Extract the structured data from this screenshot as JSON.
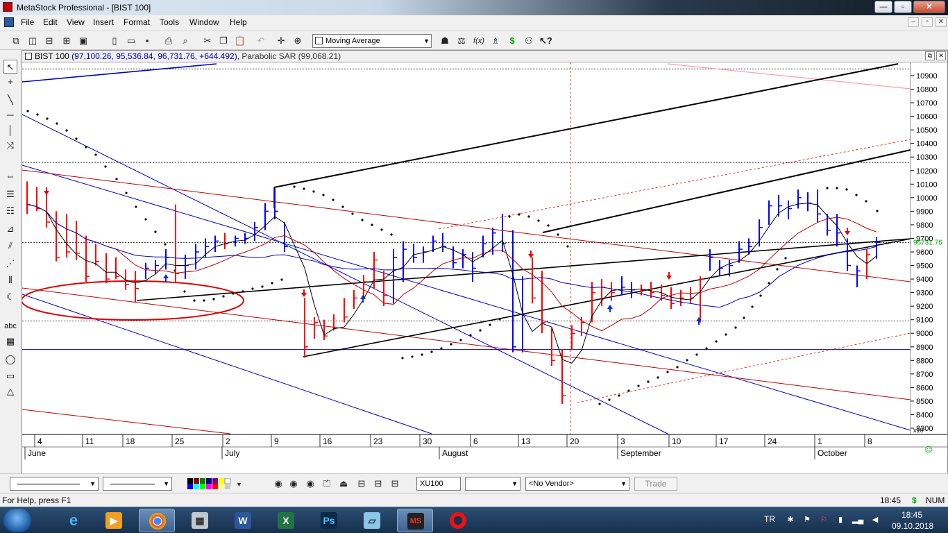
{
  "window": {
    "title": "MetaStock Professional - [BIST 100]",
    "controls": {
      "minimize": "—",
      "restore": "▫",
      "close": "✕"
    }
  },
  "menu": {
    "items": [
      "File",
      "Edit",
      "View",
      "Insert",
      "Format",
      "Tools",
      "Window",
      "Help"
    ],
    "mdi": {
      "minimize": "–",
      "restore": "▫",
      "close": "✕"
    }
  },
  "toolbar": {
    "indicator_selected": "Moving Average"
  },
  "chart": {
    "header_symbol": "BIST 100",
    "header_ohlc": "(97,100.26, 95,536.84, 96,731.76, +644.492),",
    "header_indicator": "Parabolic SAR (99,068.21)",
    "price_label": "96731.76",
    "scale_multiplier": "x10",
    "y_ticks": [
      "10900",
      "10800",
      "10700",
      "10600",
      "10500",
      "10400",
      "10300",
      "10200",
      "10100",
      "10000",
      "9900",
      "9800",
      "9700",
      "9600",
      "9500",
      "9400",
      "9300",
      "9200",
      "9100",
      "9000",
      "8900",
      "8800",
      "8700",
      "8600",
      "8500",
      "8400",
      "8300"
    ],
    "day_ticks": [
      "4",
      "11",
      "18",
      "25",
      "2",
      "9",
      "16",
      "23",
      "30",
      "6",
      "13",
      "20",
      "3",
      "10",
      "17",
      "24",
      "1",
      "8"
    ],
    "month_labels": [
      "June",
      "July",
      "August",
      "September",
      "October"
    ],
    "bar_colors": {
      "up": "#0000ff",
      "down": "#ff0000",
      "line": "#000000"
    }
  },
  "chart_data": {
    "type": "ohlc",
    "title": "BIST 100",
    "y_unit_multiplier": 10,
    "ylim": [
      8300,
      10950
    ],
    "bars": [
      {
        "x": 38,
        "h": 10120,
        "l": 9880,
        "c": 9950,
        "d": "down"
      },
      {
        "x": 52,
        "h": 10080,
        "l": 9900,
        "c": 9920,
        "d": "down"
      },
      {
        "x": 66,
        "h": 10050,
        "l": 9780,
        "c": 9820,
        "d": "down"
      },
      {
        "x": 80,
        "h": 9900,
        "l": 9530,
        "c": 9560,
        "d": "down"
      },
      {
        "x": 95,
        "h": 9880,
        "l": 9560,
        "c": 9600,
        "d": "down"
      },
      {
        "x": 109,
        "h": 9830,
        "l": 9540,
        "c": 9590,
        "d": "down"
      },
      {
        "x": 123,
        "h": 9720,
        "l": 9380,
        "c": 9420,
        "d": "down"
      },
      {
        "x": 137,
        "h": 9660,
        "l": 9500,
        "c": 9530,
        "d": "down"
      },
      {
        "x": 152,
        "h": 9590,
        "l": 9370,
        "c": 9400,
        "d": "down"
      },
      {
        "x": 166,
        "h": 9560,
        "l": 9400,
        "c": 9420,
        "d": "down"
      },
      {
        "x": 180,
        "h": 9470,
        "l": 9320,
        "c": 9360,
        "d": "down"
      },
      {
        "x": 194,
        "h": 9460,
        "l": 9230,
        "c": 9330,
        "d": "down"
      },
      {
        "x": 209,
        "h": 9520,
        "l": 9400,
        "c": 9480,
        "d": "up"
      },
      {
        "x": 223,
        "h": 9540,
        "l": 9440,
        "c": 9500,
        "d": "up"
      },
      {
        "x": 238,
        "h": 9620,
        "l": 9470,
        "c": 9560,
        "d": "up"
      },
      {
        "x": 252,
        "h": 9950,
        "l": 9380,
        "c": 9440,
        "d": "down"
      },
      {
        "x": 266,
        "h": 9580,
        "l": 9400,
        "c": 9500,
        "d": "up"
      },
      {
        "x": 281,
        "h": 9660,
        "l": 9470,
        "c": 9600,
        "d": "up"
      },
      {
        "x": 295,
        "h": 9700,
        "l": 9560,
        "c": 9640,
        "d": "up"
      },
      {
        "x": 309,
        "h": 9720,
        "l": 9600,
        "c": 9680,
        "d": "up"
      },
      {
        "x": 323,
        "h": 9740,
        "l": 9620,
        "c": 9660,
        "d": "down"
      },
      {
        "x": 338,
        "h": 9720,
        "l": 9640,
        "c": 9700,
        "d": "up"
      },
      {
        "x": 352,
        "h": 9740,
        "l": 9660,
        "c": 9700,
        "d": "up"
      },
      {
        "x": 366,
        "h": 9820,
        "l": 9680,
        "c": 9780,
        "d": "up"
      },
      {
        "x": 381,
        "h": 9960,
        "l": 9760,
        "c": 9900,
        "d": "up"
      },
      {
        "x": 395,
        "h": 10070,
        "l": 9840,
        "c": 9900,
        "d": "up"
      },
      {
        "x": 409,
        "h": 9820,
        "l": 9600,
        "c": 9640,
        "d": "up"
      },
      {
        "x": 438,
        "h": 9260,
        "l": 8820,
        "c": 8900,
        "d": "down"
      },
      {
        "x": 452,
        "h": 9120,
        "l": 8960,
        "c": 9080,
        "d": "down"
      },
      {
        "x": 466,
        "h": 9100,
        "l": 8950,
        "c": 8980,
        "d": "down"
      },
      {
        "x": 480,
        "h": 9140,
        "l": 9020,
        "c": 9040,
        "d": "down"
      },
      {
        "x": 495,
        "h": 9260,
        "l": 9080,
        "c": 9120,
        "d": "down"
      },
      {
        "x": 509,
        "h": 9320,
        "l": 9180,
        "c": 9260,
        "d": "down"
      },
      {
        "x": 523,
        "h": 9430,
        "l": 9260,
        "c": 9380,
        "d": "down"
      },
      {
        "x": 538,
        "h": 9600,
        "l": 9330,
        "c": 9540,
        "d": "down"
      },
      {
        "x": 552,
        "h": 9460,
        "l": 9200,
        "c": 9280,
        "d": "down"
      },
      {
        "x": 566,
        "h": 9620,
        "l": 9220,
        "c": 9560,
        "d": "up"
      },
      {
        "x": 580,
        "h": 9680,
        "l": 9380,
        "c": 9620,
        "d": "up"
      },
      {
        "x": 595,
        "h": 9660,
        "l": 9520,
        "c": 9560,
        "d": "up"
      },
      {
        "x": 609,
        "h": 9640,
        "l": 9520,
        "c": 9600,
        "d": "up"
      },
      {
        "x": 623,
        "h": 9720,
        "l": 9600,
        "c": 9680,
        "d": "up"
      },
      {
        "x": 637,
        "h": 9740,
        "l": 9600,
        "c": 9640,
        "d": "up"
      },
      {
        "x": 652,
        "h": 9640,
        "l": 9480,
        "c": 9520,
        "d": "up"
      },
      {
        "x": 666,
        "h": 9620,
        "l": 9480,
        "c": 9580,
        "d": "up"
      },
      {
        "x": 680,
        "h": 9600,
        "l": 9380,
        "c": 9480,
        "d": "up"
      },
      {
        "x": 695,
        "h": 9720,
        "l": 9560,
        "c": 9660,
        "d": "up"
      },
      {
        "x": 709,
        "h": 9780,
        "l": 9580,
        "c": 9740,
        "d": "up"
      },
      {
        "x": 723,
        "h": 9880,
        "l": 9600,
        "c": 9660,
        "d": "up"
      },
      {
        "x": 738,
        "h": 9760,
        "l": 8860,
        "c": 8900,
        "d": "up"
      },
      {
        "x": 752,
        "h": 9420,
        "l": 8860,
        "c": 8880,
        "d": "up"
      },
      {
        "x": 766,
        "h": 9560,
        "l": 9220,
        "c": 9260,
        "d": "down"
      },
      {
        "x": 780,
        "h": 9460,
        "l": 9000,
        "c": 9080,
        "d": "down"
      },
      {
        "x": 794,
        "h": 9040,
        "l": 8760,
        "c": 8800,
        "d": "down"
      },
      {
        "x": 809,
        "h": 8880,
        "l": 8480,
        "c": 8540,
        "d": "down"
      },
      {
        "x": 823,
        "h": 9060,
        "l": 8880,
        "c": 9000,
        "d": "down"
      },
      {
        "x": 837,
        "h": 9120,
        "l": 8980,
        "c": 9080,
        "d": "down"
      },
      {
        "x": 852,
        "h": 9380,
        "l": 9080,
        "c": 9300,
        "d": "down"
      },
      {
        "x": 866,
        "h": 9400,
        "l": 9200,
        "c": 9340,
        "d": "down"
      },
      {
        "x": 880,
        "h": 9380,
        "l": 9240,
        "c": 9300,
        "d": "down"
      },
      {
        "x": 895,
        "h": 9420,
        "l": 9280,
        "c": 9340,
        "d": "up"
      },
      {
        "x": 909,
        "h": 9380,
        "l": 9260,
        "c": 9320,
        "d": "up"
      },
      {
        "x": 923,
        "h": 9360,
        "l": 9280,
        "c": 9320,
        "d": "down"
      },
      {
        "x": 937,
        "h": 9380,
        "l": 9260,
        "c": 9300,
        "d": "down"
      },
      {
        "x": 952,
        "h": 9360,
        "l": 9240,
        "c": 9280,
        "d": "down"
      },
      {
        "x": 966,
        "h": 9340,
        "l": 9180,
        "c": 9220,
        "d": "down"
      },
      {
        "x": 980,
        "h": 9320,
        "l": 9200,
        "c": 9260,
        "d": "down"
      },
      {
        "x": 994,
        "h": 9340,
        "l": 9220,
        "c": 9260,
        "d": "down"
      },
      {
        "x": 1008,
        "h": 9420,
        "l": 9080,
        "c": 9400,
        "d": "down"
      },
      {
        "x": 1022,
        "h": 9620,
        "l": 9460,
        "c": 9560,
        "d": "up"
      },
      {
        "x": 1036,
        "h": 9540,
        "l": 9420,
        "c": 9480,
        "d": "up"
      },
      {
        "x": 1050,
        "h": 9540,
        "l": 9420,
        "c": 9500,
        "d": "up"
      },
      {
        "x": 1064,
        "h": 9680,
        "l": 9520,
        "c": 9620,
        "d": "up"
      },
      {
        "x": 1078,
        "h": 9700,
        "l": 9580,
        "c": 9640,
        "d": "up"
      },
      {
        "x": 1093,
        "h": 9840,
        "l": 9640,
        "c": 9780,
        "d": "up"
      },
      {
        "x": 1107,
        "h": 9980,
        "l": 9800,
        "c": 9940,
        "d": "up"
      },
      {
        "x": 1121,
        "h": 10020,
        "l": 9860,
        "c": 9940,
        "d": "up"
      },
      {
        "x": 1135,
        "h": 9980,
        "l": 9840,
        "c": 9920,
        "d": "up"
      },
      {
        "x": 1149,
        "h": 10060,
        "l": 9920,
        "c": 10000,
        "d": "up"
      },
      {
        "x": 1163,
        "h": 10040,
        "l": 9900,
        "c": 9960,
        "d": "up"
      },
      {
        "x": 1177,
        "h": 10060,
        "l": 9820,
        "c": 9880,
        "d": "up"
      },
      {
        "x": 1191,
        "h": 9880,
        "l": 9720,
        "c": 9760,
        "d": "up"
      },
      {
        "x": 1205,
        "h": 9880,
        "l": 9640,
        "c": 9740,
        "d": "up"
      },
      {
        "x": 1220,
        "h": 9700,
        "l": 9460,
        "c": 9500,
        "d": "up"
      },
      {
        "x": 1234,
        "h": 9500,
        "l": 9340,
        "c": 9460,
        "d": "up"
      },
      {
        "x": 1248,
        "h": 9620,
        "l": 9400,
        "c": 9580,
        "d": "down"
      },
      {
        "x": 1262,
        "h": 9710,
        "l": 9550,
        "c": 9670,
        "d": "up"
      }
    ]
  },
  "formatbar": {
    "symbol_field": "XU100",
    "vendor": "<No Vendor>",
    "trade_label": "Trade"
  },
  "statusbar": {
    "help_text": "For Help, press F1",
    "time": "18:45",
    "mode": "NUM"
  },
  "taskbar": {
    "language": "TR",
    "clock_time": "18:45",
    "clock_date": "09.10.2018"
  }
}
